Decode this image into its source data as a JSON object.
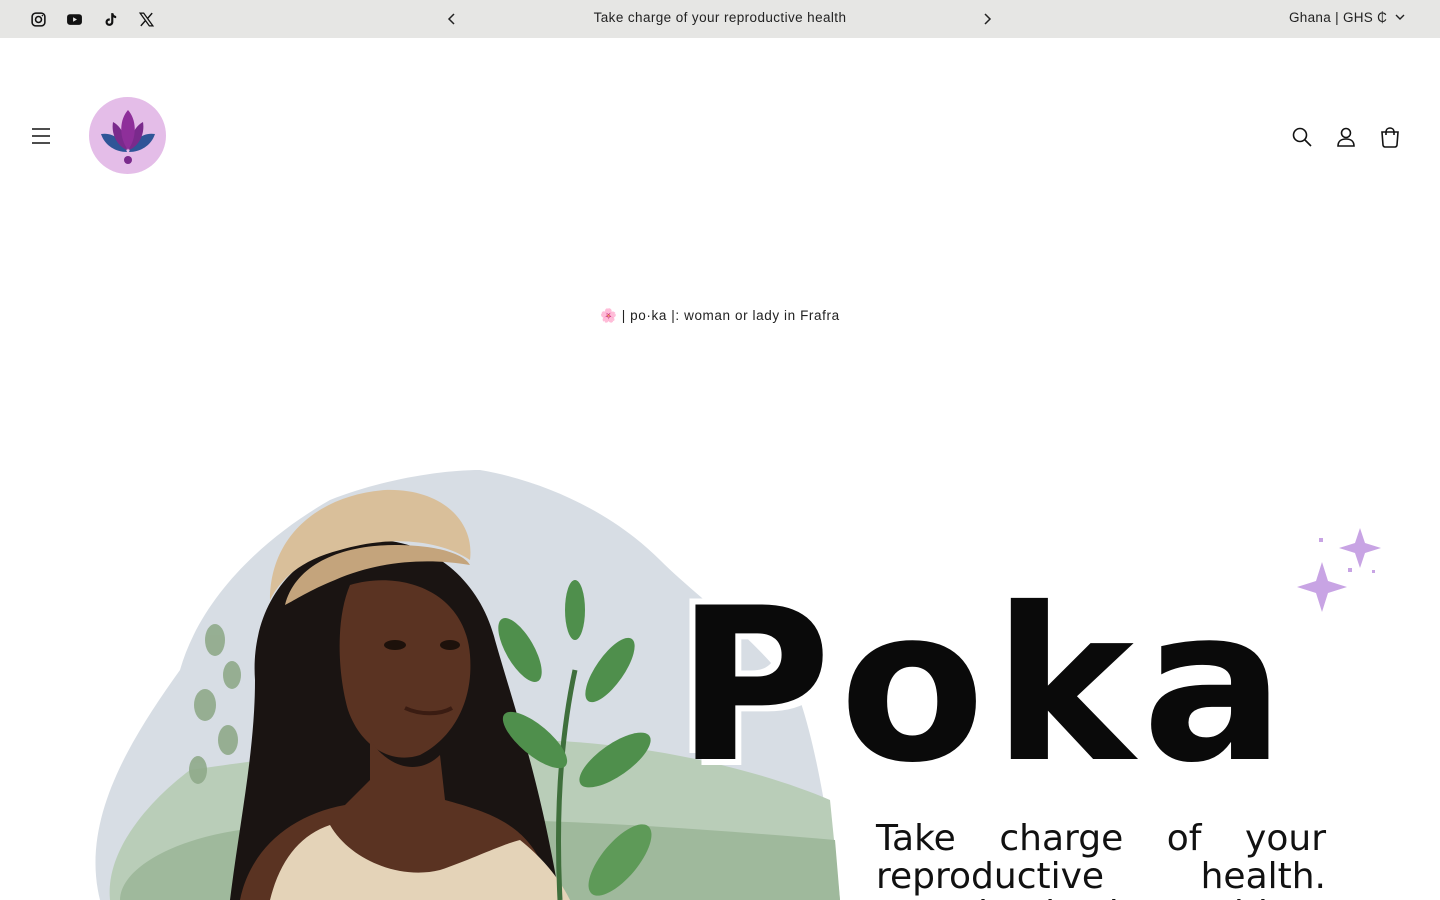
{
  "announcement": {
    "social": [
      {
        "name": "instagram-icon"
      },
      {
        "name": "youtube-icon"
      },
      {
        "name": "tiktok-icon"
      },
      {
        "name": "x-icon"
      }
    ],
    "message": "Take charge of your reproductive health",
    "country_selector": "Ghana | GHS ₵"
  },
  "header": {
    "icons": [
      "menu-icon",
      "search-icon",
      "account-icon",
      "cart-icon"
    ]
  },
  "tagline": {
    "flower": "🌸",
    "text": "| po·ka |: woman or lady in Frafra"
  },
  "hero": {
    "title": "Poka",
    "subtitle": "Take charge of your reproductive health. Download Poka Health"
  },
  "colors": {
    "announcement_bg": "#e6e6e4",
    "logo_bg": "#e4bde8",
    "logo_purple": "#7a2a8c",
    "logo_blue": "#2f5597",
    "sparkle": "#c8a4e4"
  }
}
